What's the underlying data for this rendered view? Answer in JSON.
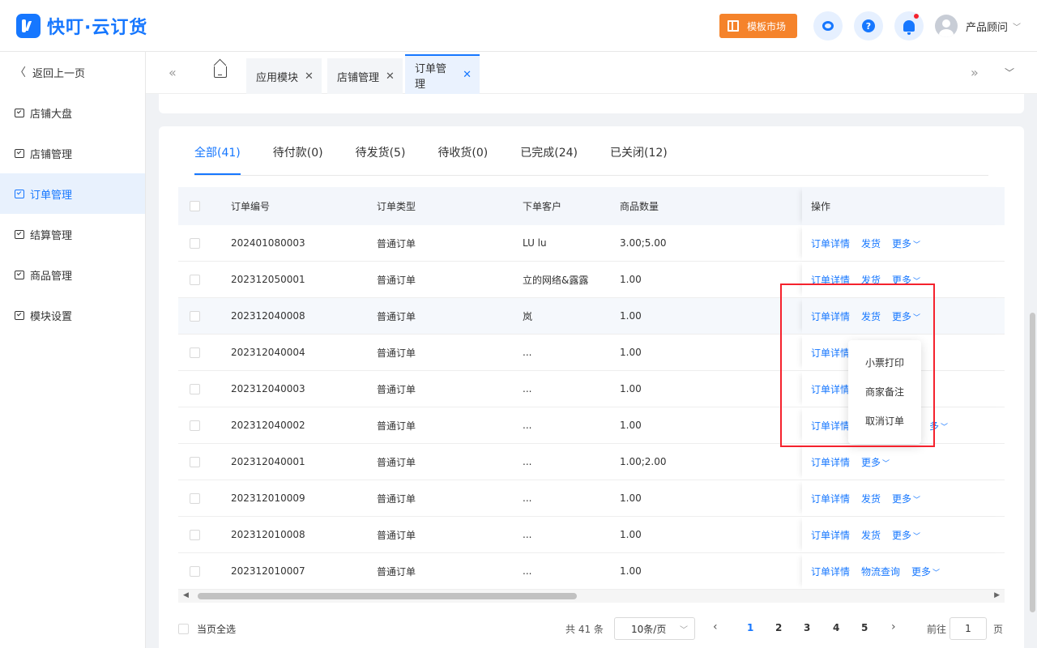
{
  "app": {
    "title": "快叮·云订货"
  },
  "header": {
    "market_label": "模板市场",
    "help_glyph": "?",
    "user_name": "产品顾问",
    "accent_color": "#1677ff",
    "market_color": "#f5832b"
  },
  "sidebar": {
    "back_label": "返回上一页",
    "items": [
      {
        "label": "店铺大盘"
      },
      {
        "label": "店铺管理"
      },
      {
        "label": "订单管理",
        "active": true
      },
      {
        "label": "结算管理"
      },
      {
        "label": "商品管理"
      },
      {
        "label": "模块设置"
      }
    ]
  },
  "tabs": [
    {
      "label": "应用模块"
    },
    {
      "label": "店铺管理"
    },
    {
      "label": "订单管理",
      "active": true
    }
  ],
  "status_tabs": [
    {
      "label": "全部(41)",
      "active": true
    },
    {
      "label": "待付款(0)"
    },
    {
      "label": "待发货(5)"
    },
    {
      "label": "待收货(0)"
    },
    {
      "label": "已完成(24)"
    },
    {
      "label": "已关闭(12)"
    }
  ],
  "table": {
    "headers": [
      "订单编号",
      "订单类型",
      "下单客户",
      "商品数量",
      "操作"
    ],
    "rows": [
      {
        "id": "202401080003",
        "type": "普通订单",
        "customer": "LU lu",
        "qty": "3.00;5.00",
        "actions": [
          "订单详情",
          "发货"
        ],
        "more": "更多"
      },
      {
        "id": "202312050001",
        "type": "普通订单",
        "customer": "立的网络&露露",
        "qty": "1.00",
        "actions": [
          "订单详情",
          "发货"
        ],
        "more": "更多"
      },
      {
        "id": "202312040008",
        "type": "普通订单",
        "customer": "岚",
        "qty": "1.00",
        "actions": [
          "订单详情",
          "发货"
        ],
        "more": "更多"
      },
      {
        "id": "202312040004",
        "type": "普通订单",
        "customer": "...",
        "qty": "1.00",
        "actions": [
          "订单详情"
        ],
        "more": ""
      },
      {
        "id": "202312040003",
        "type": "普通订单",
        "customer": "...",
        "qty": "1.00",
        "actions": [
          "订单详情"
        ],
        "more": ""
      },
      {
        "id": "202312040002",
        "type": "普通订单",
        "customer": "...",
        "qty": "1.00",
        "actions": [
          "订单详情"
        ],
        "more": "多"
      },
      {
        "id": "202312040001",
        "type": "普通订单",
        "customer": "...",
        "qty": "1.00;2.00",
        "actions": [
          "订单详情"
        ],
        "more": "更多"
      },
      {
        "id": "202312010009",
        "type": "普通订单",
        "customer": "...",
        "qty": "1.00",
        "actions": [
          "订单详情",
          "发货"
        ],
        "more": "更多"
      },
      {
        "id": "202312010008",
        "type": "普通订单",
        "customer": "...",
        "qty": "1.00",
        "actions": [
          "订单详情",
          "发货"
        ],
        "more": "更多"
      },
      {
        "id": "202312010007",
        "type": "普通订单",
        "customer": "...",
        "qty": "1.00",
        "actions": [
          "订单详情",
          "物流查询"
        ],
        "more": "更多"
      }
    ]
  },
  "dropdown": {
    "items": [
      "小票打印",
      "商家备注",
      "取消订单"
    ]
  },
  "footer": {
    "select_all": "当页全选",
    "total": "共 41 条",
    "page_size": "10条/页",
    "pages": [
      "1",
      "2",
      "3",
      "4",
      "5"
    ],
    "current_page": "1",
    "goto_prefix": "前往",
    "goto_value": "1",
    "goto_suffix": "页"
  }
}
